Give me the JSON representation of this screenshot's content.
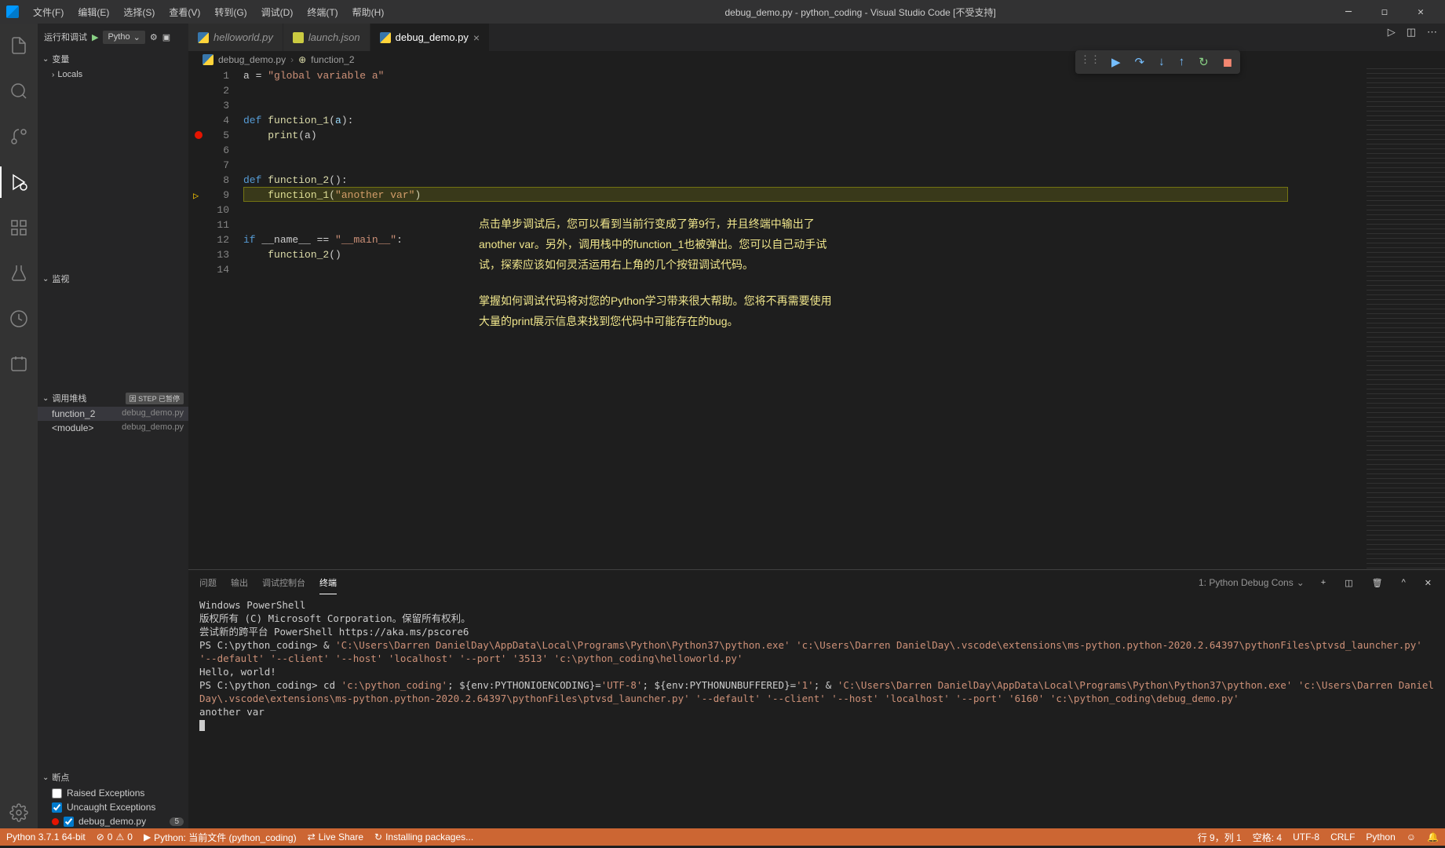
{
  "titlebar": {
    "menus": [
      "文件(F)",
      "编辑(E)",
      "选择(S)",
      "查看(V)",
      "转到(G)",
      "调试(D)",
      "终端(T)",
      "帮助(H)"
    ],
    "title": "debug_demo.py - python_coding - Visual Studio Code [不受支持]"
  },
  "sidebar": {
    "debug_label": "运行和调试",
    "config_name": "Pytho",
    "variables": "变量",
    "locals": "Locals",
    "watch": "监视",
    "callstack": "调用堆栈",
    "callstack_status": "因 STEP 已暂停",
    "stack": [
      {
        "fn": "function_2",
        "file": "debug_demo.py"
      },
      {
        "fn": "<module>",
        "file": "debug_demo.py"
      }
    ],
    "breakpoints": "断点",
    "bp_raised": "Raised Exceptions",
    "bp_uncaught": "Uncaught Exceptions",
    "bp_file": "debug_demo.py",
    "bp_count": "5"
  },
  "tabs": [
    {
      "name": "helloworld.py",
      "active": false
    },
    {
      "name": "launch.json",
      "active": false
    },
    {
      "name": "debug_demo.py",
      "active": true
    }
  ],
  "breadcrumb": {
    "file": "debug_demo.py",
    "symbol": "function_2"
  },
  "code": {
    "lines": [
      {
        "n": 1,
        "html": "a <span class='op'>=</span> <span class='str'>\"global variable a\"</span>"
      },
      {
        "n": 2,
        "html": ""
      },
      {
        "n": 3,
        "html": ""
      },
      {
        "n": 4,
        "html": "<span class='kw'>def</span> <span class='fn'>function_1</span>(<span class='var'>a</span>):"
      },
      {
        "n": 5,
        "html": "    <span class='fn'>print</span>(a)"
      },
      {
        "n": 6,
        "html": ""
      },
      {
        "n": 7,
        "html": ""
      },
      {
        "n": 8,
        "html": "<span class='kw'>def</span> <span class='fn'>function_2</span>():"
      },
      {
        "n": 9,
        "html": "    <span class='fn'>function_1</span>(<span class='str'>\"another var\"</span>)"
      },
      {
        "n": 10,
        "html": ""
      },
      {
        "n": 11,
        "html": ""
      },
      {
        "n": 12,
        "html": "<span class='kw'>if</span> __name__ <span class='op'>==</span> <span class='str'>\"__main__\"</span>:"
      },
      {
        "n": 13,
        "html": "    <span class='fn'>function_2</span>()"
      },
      {
        "n": 14,
        "html": ""
      }
    ],
    "breakpoint_line": 5,
    "current_line": 9
  },
  "annotation": {
    "p1": "点击单步调试后，您可以看到当前行变成了第9行，并且终端中输出了another var。另外，调用栈中的function_1也被弹出。您可以自己动手试试，探索应该如何灵活运用右上角的几个按钮调试代码。",
    "p2": "掌握如何调试代码将对您的Python学习带来很大帮助。您将不再需要使用大量的print展示信息来找到您代码中可能存在的bug。"
  },
  "panel": {
    "tabs": [
      "问题",
      "输出",
      "调试控制台",
      "终端"
    ],
    "active_tab": 3,
    "terminal_name": "1: Python Debug Cons",
    "terminal_lines": [
      "Windows PowerShell",
      "版权所有 (C) Microsoft Corporation。保留所有权利。",
      "",
      "尝试新的跨平台 PowerShell https://aka.ms/pscore6",
      "",
      "PS C:\\python_coding> & 'C:\\Users\\Darren DanielDay\\AppData\\Local\\Programs\\Python\\Python37\\python.exe' 'c:\\Users\\Darren DanielDay\\.vscode\\extensions\\ms-python.python-2020.2.64397\\pythonFiles\\ptvsd_launcher.py' '--default' '--client' '--host' 'localhost' '--port' '3513' 'c:\\python_coding\\helloworld.py'",
      "Hello, world!",
      "PS C:\\python_coding> cd 'c:\\python_coding'; ${env:PYTHONIOENCODING}='UTF-8'; ${env:PYTHONUNBUFFERED}='1'; & 'C:\\Users\\Darren DanielDay\\AppData\\Local\\Programs\\Python\\Python37\\python.exe' 'c:\\Users\\Darren DanielDay\\.vscode\\extensions\\ms-python.python-2020.2.64397\\pythonFiles\\ptvsd_launcher.py' '--default' '--client' '--host' 'localhost' '--port' '6160' 'c:\\python_coding\\debug_demo.py'",
      "another var"
    ]
  },
  "statusbar": {
    "python": "Python 3.7.1 64-bit",
    "errors": "0",
    "warnings": "0",
    "debug_target": "Python: 当前文件 (python_coding)",
    "liveshare": "Live Share",
    "installing": "Installing packages...",
    "line_col": "行 9，列 1",
    "spaces": "空格: 4",
    "encoding": "UTF-8",
    "eol": "CRLF",
    "lang": "Python"
  }
}
